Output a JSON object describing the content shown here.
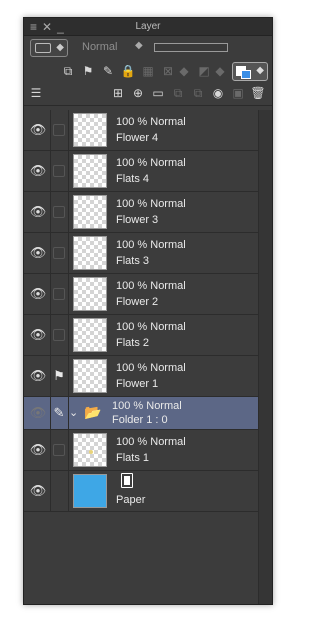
{
  "window": {
    "title": "Layer"
  },
  "blend": {
    "mode": "Normal"
  },
  "layers": [
    {
      "opacity_mode": "100 % Normal",
      "name": "Flower 4"
    },
    {
      "opacity_mode": "100 % Normal",
      "name": "Flats 4"
    },
    {
      "opacity_mode": "100 % Normal",
      "name": "Flower 3"
    },
    {
      "opacity_mode": "100 % Normal",
      "name": "Flats 3"
    },
    {
      "opacity_mode": "100 % Normal",
      "name": "Flower 2"
    },
    {
      "opacity_mode": "100 % Normal",
      "name": "Flats 2"
    },
    {
      "opacity_mode": "100 % Normal",
      "name": "Flower 1"
    },
    {
      "opacity_mode": "100 % Normal",
      "name": "Folder 1 : 0"
    },
    {
      "opacity_mode": "100 % Normal",
      "name": "Flats 1"
    },
    {
      "name": "Paper"
    }
  ],
  "colors": {
    "panel_bg": "#3c3c3c",
    "selected_row": "#5c6786",
    "paper_color": "#3ea7e6",
    "accent_blue": "#3a8ee6"
  }
}
